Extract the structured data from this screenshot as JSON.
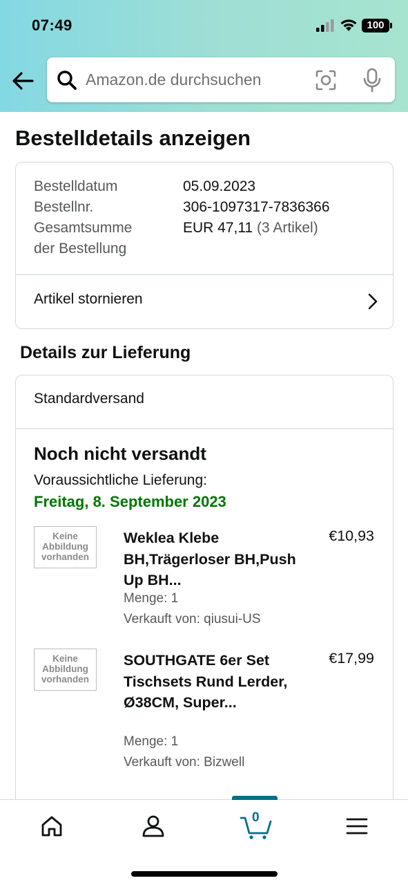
{
  "status_bar": {
    "time": "07:49",
    "battery": "100"
  },
  "search": {
    "placeholder": "Amazon.de durchsuchen"
  },
  "page": {
    "title": "Bestelldetails anzeigen"
  },
  "order": {
    "date_label": "Bestelldatum",
    "date_value": "05.09.2023",
    "number_label": "Bestellnr.",
    "number_value": "306-1097317-7836366",
    "total_label_line1": "Gesamtsumme",
    "total_label_line2": "der Bestellung",
    "total_value": "EUR 47,11",
    "total_items": "(3 Artikel)",
    "cancel_label": "Artikel stornieren"
  },
  "delivery": {
    "section_title": "Details zur Lieferung",
    "method": "Standardversand",
    "status": "Noch nicht versandt",
    "eta_label": "Voraussichtliche Lieferung:",
    "eta_date": "Freitag, 8. September 2023"
  },
  "items": [
    {
      "thumb_text": [
        "Keine",
        "Abbildung",
        "vorhanden"
      ],
      "title": "Weklea Klebe BH,Trägerloser BH,Push Up BH...",
      "price": "€10,93",
      "quantity": "Menge: 1",
      "seller": "Verkauft von: qiusui-US"
    },
    {
      "thumb_text": [
        "Keine",
        "Abbildung",
        "vorhanden"
      ],
      "title": "SOUTHGATE 6er Set Tischsets Rund Lerder, Ø38CM, Super...",
      "price": "€17,99",
      "quantity": "Menge: 1",
      "seller": "Verkauft von: Bizwell"
    }
  ],
  "bottom_nav": {
    "cart_count": "0"
  },
  "colors": {
    "accent": "#007185",
    "eta_green": "#007600",
    "header_start": "#84d8e3",
    "header_end": "#a6e4cf"
  }
}
